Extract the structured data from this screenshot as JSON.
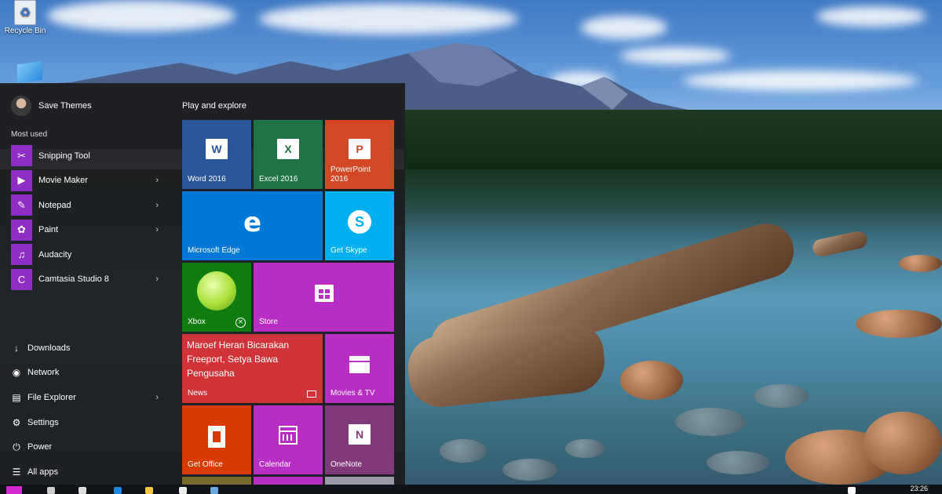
{
  "desktop": {
    "recycle_bin_label": "Recycle Bin"
  },
  "start_menu": {
    "user_name": "Save Themes",
    "most_used_label": "Most used",
    "most_used": [
      {
        "label": "Snipping Tool",
        "icon": "scissors-icon",
        "color": "#8e2ec4",
        "has_submenu": false
      },
      {
        "label": "Movie Maker",
        "icon": "film-icon",
        "color": "#8e2ec4",
        "has_submenu": true
      },
      {
        "label": "Notepad",
        "icon": "notepad-icon",
        "color": "#8e2ec4",
        "has_submenu": true
      },
      {
        "label": "Paint",
        "icon": "palette-icon",
        "color": "#8e2ec4",
        "has_submenu": true
      },
      {
        "label": "Audacity",
        "icon": "headphones-icon",
        "color": "#8e2ec4",
        "has_submenu": false
      },
      {
        "label": "Camtasia Studio 8",
        "icon": "camtasia-icon",
        "color": "#8e2ec4",
        "has_submenu": true
      }
    ],
    "system": [
      {
        "label": "Downloads",
        "icon": "download-icon",
        "has_submenu": false
      },
      {
        "label": "Network",
        "icon": "network-icon",
        "has_submenu": false
      },
      {
        "label": "File Explorer",
        "icon": "folder-icon",
        "has_submenu": true
      },
      {
        "label": "Settings",
        "icon": "gear-icon",
        "has_submenu": false
      },
      {
        "label": "Power",
        "icon": "power-icon",
        "has_submenu": false
      },
      {
        "label": "All apps",
        "icon": "list-icon",
        "has_submenu": false
      }
    ],
    "tiles_group_title": "Play and explore",
    "tiles": {
      "word": {
        "label": "Word 2016",
        "glyph": "W",
        "color": "#2b579a"
      },
      "excel": {
        "label": "Excel 2016",
        "glyph": "X",
        "color": "#217346"
      },
      "powerpoint": {
        "label": "PowerPoint 2016",
        "glyph": "P",
        "color": "#d24726"
      },
      "edge": {
        "label": "Microsoft Edge",
        "glyph": "e",
        "color": "#0078d7"
      },
      "skype": {
        "label": "Get Skype",
        "glyph": "S",
        "color": "#00aff0"
      },
      "xbox": {
        "label": "Xbox",
        "color": "#107c10"
      },
      "store": {
        "label": "Store",
        "color": "#b82ec4"
      },
      "news": {
        "label": "News",
        "headline": "Maroef Heran Bicarakan Freeport, Setya Bawa Pengusaha",
        "color": "#d13438"
      },
      "movies": {
        "label": "Movies & TV",
        "color": "#b82ec4"
      },
      "office": {
        "label": "Get Office",
        "color": "#d83b01"
      },
      "calendar": {
        "label": "Calendar",
        "color": "#b82ec4"
      },
      "onenote": {
        "label": "OneNote",
        "glyph": "N",
        "color": "#80397b"
      }
    }
  },
  "taskbar": {
    "clock": "23:26"
  }
}
